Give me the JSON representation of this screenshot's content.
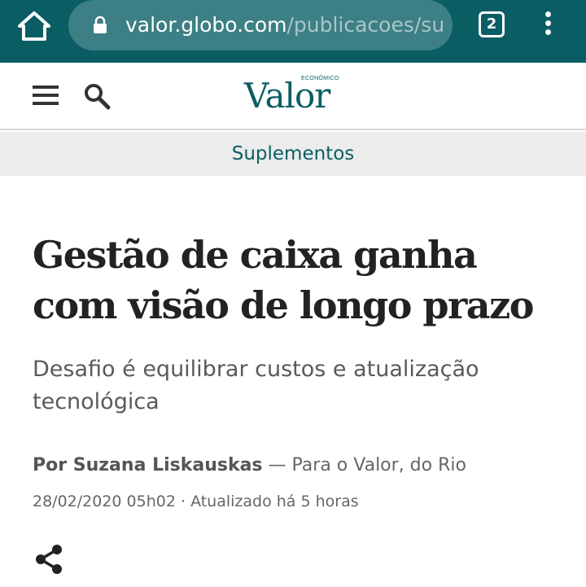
{
  "browser": {
    "url_host": "valor.globo.com",
    "url_path": "/publicacoes/su",
    "tab_count": "2",
    "icons": {
      "home": "home-icon",
      "lock": "lock-icon",
      "menu": "more-vert-icon"
    },
    "bar_color": "#0a5d63"
  },
  "site": {
    "logo_text": "Valor",
    "logo_sup": "ECONÔMICO",
    "icons": {
      "menu": "hamburger-icon",
      "search": "search-icon"
    },
    "brand_color": "#0b5e63"
  },
  "section": {
    "label": "Suplementos"
  },
  "article": {
    "headline": "Gestão de caixa ganha com visão de longo prazo",
    "subtitle": "Desafio é equilibrar custos e atualização tecnológica",
    "author": "Por Suzana Liskauskas",
    "source": " — Para o Valor, do Rio",
    "date": "28/02/2020 05h02 · Atualizado há 5 horas",
    "share_icon": "share-icon"
  }
}
